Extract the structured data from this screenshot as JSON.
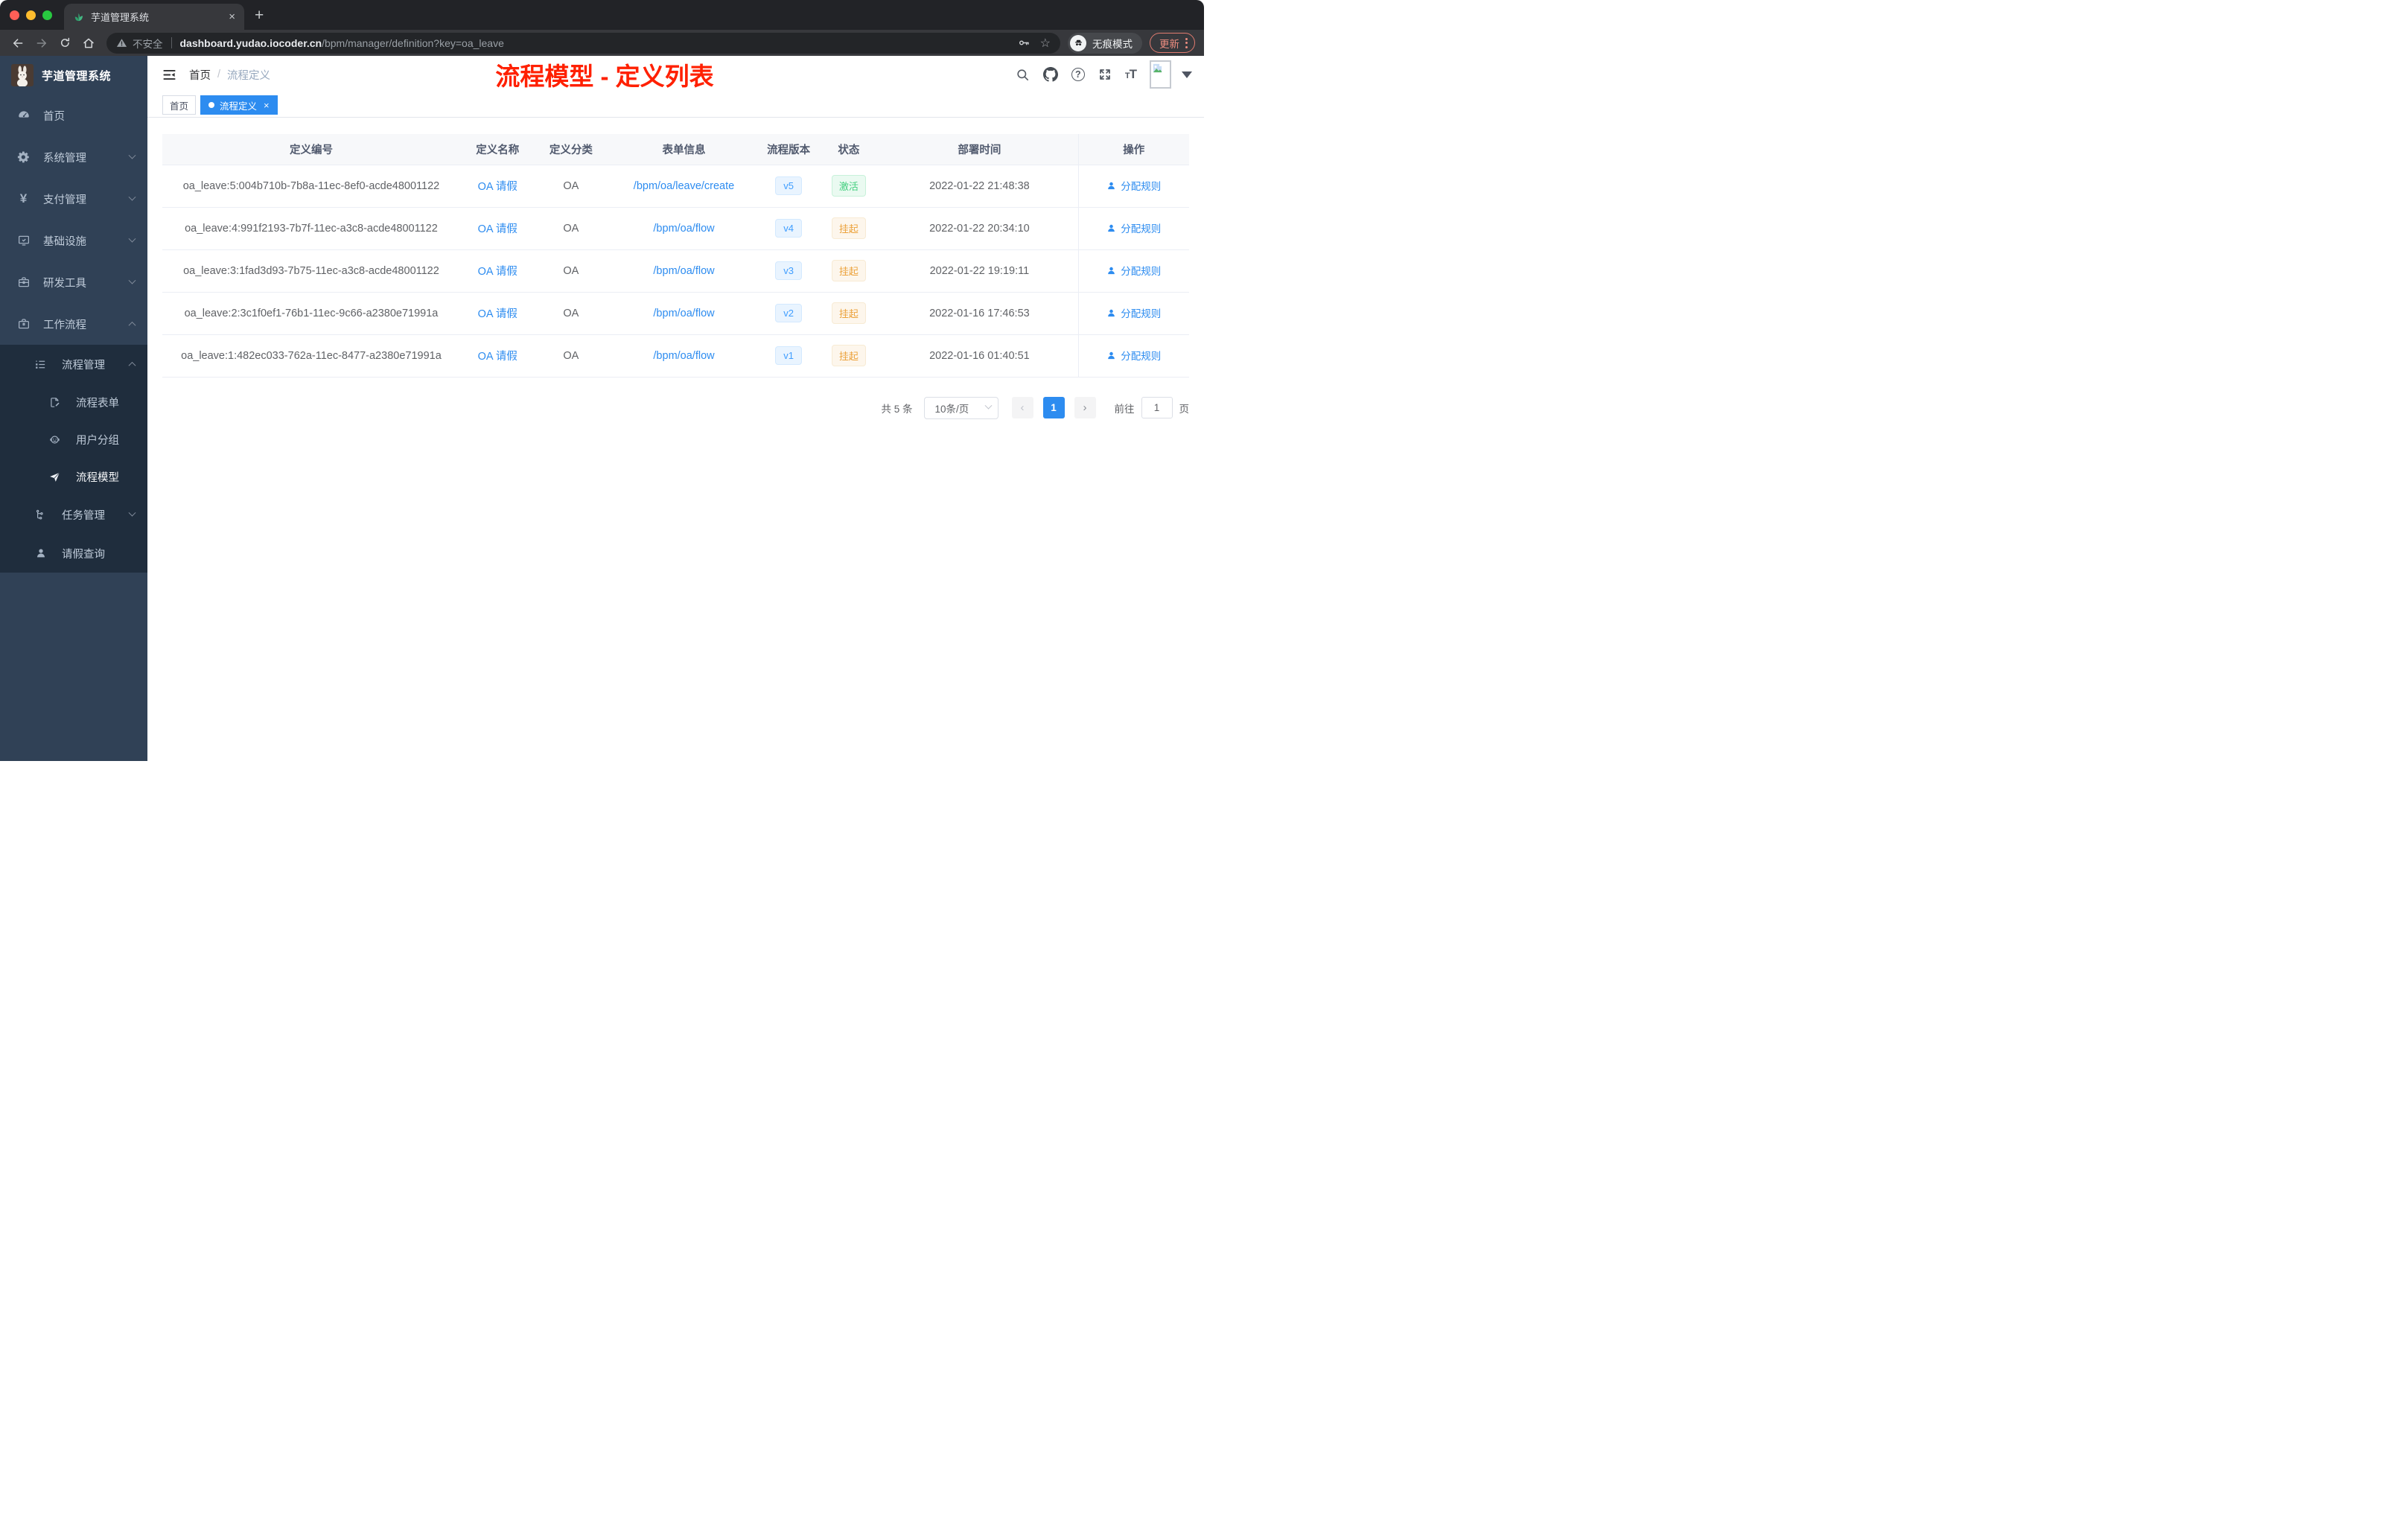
{
  "browser": {
    "tab": {
      "title": "芋道管理系统",
      "close_glyph": "×",
      "new_tab_glyph": "+"
    },
    "address": {
      "security_label": "不安全",
      "url_host": "dashboard.yudao.iocoder.cn",
      "url_path": "/bpm/manager/definition?key=oa_leave"
    },
    "incognito_label": "无痕模式",
    "update_button": "更新"
  },
  "sidebar": {
    "app_title": "芋道管理系统",
    "menu": [
      {
        "label": "首页",
        "icon": "dashboard-icon"
      },
      {
        "label": "系统管理",
        "icon": "gear-icon"
      },
      {
        "label": "支付管理",
        "icon": "yen-icon"
      },
      {
        "label": "基础设施",
        "icon": "monitor-icon"
      },
      {
        "label": "研发工具",
        "icon": "toolbox-icon"
      },
      {
        "label": "工作流程",
        "icon": "briefcase-icon"
      }
    ],
    "submenu": [
      {
        "label": "流程管理",
        "icon": "tree-list-icon"
      },
      {
        "label": "流程表单",
        "icon": "form-icon"
      },
      {
        "label": "用户分组",
        "icon": "robot-icon"
      },
      {
        "label": "流程模型",
        "icon": "paper-plane-icon"
      },
      {
        "label": "任务管理",
        "icon": "org-icon"
      },
      {
        "label": "请假查询",
        "icon": "person-icon"
      }
    ]
  },
  "navbar": {
    "breadcrumb_home": "首页",
    "breadcrumb_separator": "/",
    "breadcrumb_current": "流程定义",
    "annotation": "流程模型 - 定义列表"
  },
  "tags": {
    "home": "首页",
    "active": "流程定义"
  },
  "table": {
    "columns": [
      "定义编号",
      "定义名称",
      "定义分类",
      "表单信息",
      "流程版本",
      "状态",
      "部署时间",
      "操作"
    ],
    "action_label": "分配规则",
    "rows": [
      {
        "id": "oa_leave:5:004b710b-7b8a-11ec-8ef0-acde48001122",
        "name": "OA 请假",
        "category": "OA",
        "form": "/bpm/oa/leave/create",
        "version": "v5",
        "status": "激活",
        "deployed_at": "2022-01-22 21:48:38"
      },
      {
        "id": "oa_leave:4:991f2193-7b7f-11ec-a3c8-acde48001122",
        "name": "OA 请假",
        "category": "OA",
        "form": "/bpm/oa/flow",
        "version": "v4",
        "status": "挂起",
        "deployed_at": "2022-01-22 20:34:10"
      },
      {
        "id": "oa_leave:3:1fad3d93-7b75-11ec-a3c8-acde48001122",
        "name": "OA 请假",
        "category": "OA",
        "form": "/bpm/oa/flow",
        "version": "v3",
        "status": "挂起",
        "deployed_at": "2022-01-22 19:19:11"
      },
      {
        "id": "oa_leave:2:3c1f0ef1-76b1-11ec-9c66-a2380e71991a",
        "name": "OA 请假",
        "category": "OA",
        "form": "/bpm/oa/flow",
        "version": "v2",
        "status": "挂起",
        "deployed_at": "2022-01-16 17:46:53"
      },
      {
        "id": "oa_leave:1:482ec033-762a-11ec-8477-a2380e71991a",
        "name": "OA 请假",
        "category": "OA",
        "form": "/bpm/oa/flow",
        "version": "v1",
        "status": "挂起",
        "deployed_at": "2022-01-16 01:40:51"
      }
    ]
  },
  "pagination": {
    "total": "共 5 条",
    "page_size": "10条/页",
    "current_page": "1",
    "goto_label": "前往",
    "goto_value": "1",
    "page_unit": "页"
  },
  "colors": {
    "accent": "#2d8cf0",
    "version_badge": "#409eff",
    "status_active": "#42cf7e",
    "status_suspended": "#eca23b",
    "annotation_red": "#ff2000",
    "sidebar_bg": "#304156",
    "submenu_bg": "#1f2d3d"
  }
}
